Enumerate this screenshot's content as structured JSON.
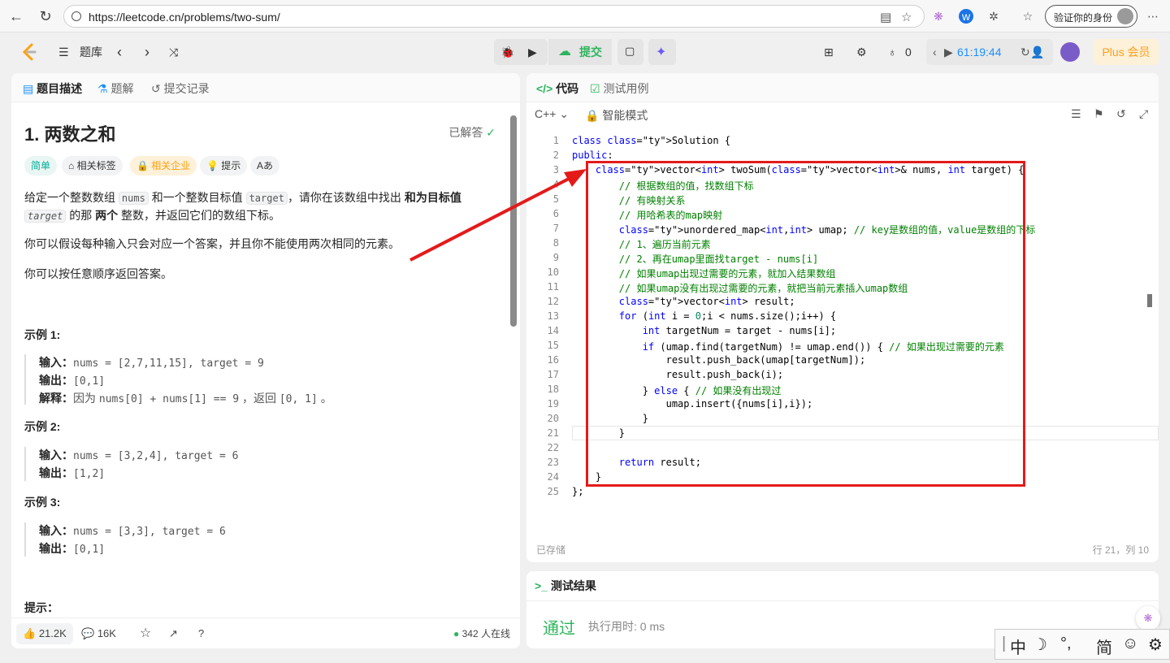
{
  "browser": {
    "url": "https://leetcode.cn/problems/two-sum/",
    "verify_label": "验证你的身份"
  },
  "topbar": {
    "problem_list_label": "题库",
    "submit_label": "提交",
    "streak_count": "0",
    "timer": "61:19:44",
    "plus_label": "Plus 会员"
  },
  "left_tabs": [
    "题目描述",
    "题解",
    "提交记录"
  ],
  "problem": {
    "title": "1. 两数之和",
    "status": "已解答",
    "tags": [
      "简单",
      "相关标签",
      "相关企业",
      "提示",
      "Aあ"
    ],
    "desc_p1_a": "给定一个整数数组",
    "desc_p1_nums": "nums",
    "desc_p1_b": "和一个整数目标值",
    "desc_p1_target": "target",
    "desc_p1_c": "，请你在该数组中找出",
    "desc_p1_bold": "和为目标值",
    "desc_p1_target2": "target",
    "desc_p1_d": "的那",
    "desc_p1_bold2": "两个",
    "desc_p1_e": "整数，并返回它们的数组下标。",
    "desc_p2": "你可以假设每种输入只会对应一个答案，并且你不能使用两次相同的元素。",
    "desc_p3": "你可以按任意顺序返回答案。",
    "examples": [
      {
        "title": "示例 1:",
        "input_label": "输入：",
        "input": "nums = [2,7,11,15], target = 9",
        "output_label": "输出：",
        "output": "[0,1]",
        "explain_label": "解释：",
        "explain_a": "因为 ",
        "explain_code": "nums[0] + nums[1] == 9",
        "explain_b": " ，返回 ",
        "explain_code2": "[0, 1]",
        "explain_c": " 。"
      },
      {
        "title": "示例 2:",
        "input_label": "输入：",
        "input": "nums = [3,2,4], target = 6",
        "output_label": "输出：",
        "output": "[1,2]"
      },
      {
        "title": "示例 3:",
        "input_label": "输入：",
        "input": "nums = [3,3], target = 6",
        "output_label": "输出：",
        "output": "[0,1]"
      }
    ],
    "hint_heading": "提示："
  },
  "left_footer": {
    "likes": "21.2K",
    "comments": "16K",
    "online": "342 人在线"
  },
  "code_tabs": [
    "代码",
    "测试用例"
  ],
  "editor": {
    "language": "C++",
    "mode": "智能模式",
    "saved": "已存储",
    "cursor": "行 21，列 10",
    "lines": [
      "class Solution {",
      "public:",
      "    vector<int> twoSum(vector<int>& nums, int target) {",
      "        // 根据数组的值，找数组下标",
      "        // 有映射关系",
      "        // 用哈希表的map映射",
      "        unordered_map<int,int> umap; // key是数组的值，value是数组的下标",
      "        // 1、遍历当前元素",
      "        // 2、再在umap里面找target - nums[i]",
      "        // 如果umap出现过需要的元素，就加入结果数组",
      "        // 如果umap没有出现过需要的元素，就把当前元素插入umap数组",
      "        vector<int> result;",
      "        for (int i = 0;i < nums.size();i++) {",
      "            int targetNum = target - nums[i];",
      "            if (umap.find(targetNum) != umap.end()) { // 如果出现过需要的元素",
      "                result.push_back(umap[targetNum]);",
      "                result.push_back(i);",
      "            } else { // 如果没有出现过",
      "                umap.insert({nums[i],i});",
      "            }",
      "        }",
      "",
      "        return result;",
      "    }",
      "};"
    ]
  },
  "result": {
    "title": "测试结果",
    "status": "通过",
    "runtime": "执行用时: 0 ms"
  },
  "ime": {
    "chars": [
      "中",
      "简"
    ]
  },
  "colors": {
    "accent": "#2db55d",
    "annotation": "#e41a1a",
    "easy": "#00af9b",
    "plus": "#ff9e1c"
  }
}
